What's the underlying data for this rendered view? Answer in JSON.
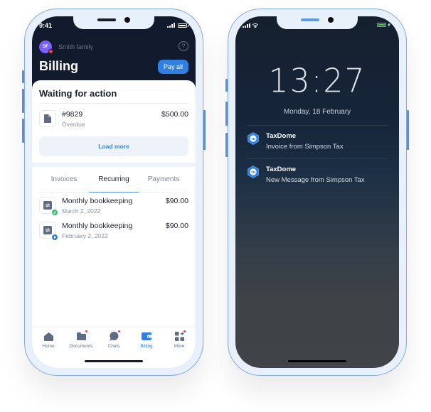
{
  "left_phone": {
    "status_time": "9:41",
    "family": {
      "initials": "SF",
      "name": "Smith family"
    },
    "help_icon": "?",
    "title": "Billing",
    "pay_all_label": "Pay all",
    "waiting": {
      "title": "Waiting for action",
      "items": [
        {
          "number": "#9829",
          "status": "Overdue",
          "amount": "$500.00",
          "icon": "document-icon"
        }
      ],
      "load_more_label": "Load more"
    },
    "tabs": [
      {
        "label": "Invoices",
        "active": false
      },
      {
        "label": "Recurring",
        "active": true
      },
      {
        "label": "Payments",
        "active": false
      }
    ],
    "recurring": [
      {
        "title": "Monthly bookkeeping",
        "date": "March 2, 2022",
        "amount": "$90.00",
        "status": "paid",
        "badge_color": "#2fbf71"
      },
      {
        "title": "Monthly bookkeeping",
        "date": "February 2, 2022",
        "amount": "$90.00",
        "status": "active",
        "badge_color": "#2f80e0"
      }
    ],
    "tabbar": [
      {
        "label": "Home",
        "icon": "home-icon",
        "dot": false,
        "active": false
      },
      {
        "label": "Documents",
        "icon": "folder-icon",
        "dot": true,
        "active": false
      },
      {
        "label": "Chats",
        "icon": "chat-icon",
        "dot": true,
        "active": false
      },
      {
        "label": "Billing",
        "icon": "wallet-icon",
        "dot": false,
        "active": true
      },
      {
        "label": "More",
        "icon": "grid-plus-icon",
        "dot": true,
        "active": false
      }
    ]
  },
  "right_phone": {
    "clock": "13:27",
    "date": "Monday, 18 February",
    "notifications": [
      {
        "app": "TaxDome",
        "logo_text": "TD",
        "message": "Invoice from Simpson Tax"
      },
      {
        "app": "TaxDome",
        "logo_text": "TD",
        "message": "New Message from Simpson Tax"
      }
    ]
  },
  "colors": {
    "accent": "#2f80e0",
    "app_dark": "#121a2e",
    "frame": "#e8f0fc",
    "frame_border": "#7fa9e0",
    "success": "#2fbf71",
    "alert": "#e8453c",
    "battery_green": "#3fd14a"
  }
}
